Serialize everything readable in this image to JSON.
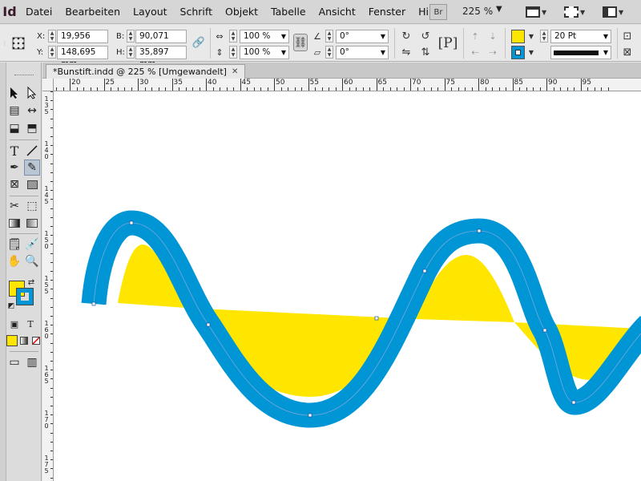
{
  "app": {
    "logo": "Id"
  },
  "menu": [
    {
      "label": "Datei"
    },
    {
      "label": "Bearbeiten"
    },
    {
      "label": "Layout"
    },
    {
      "label": "Schrift"
    },
    {
      "label": "Objekt"
    },
    {
      "label": "Tabelle"
    },
    {
      "label": "Ansicht"
    },
    {
      "label": "Fenster"
    },
    {
      "label": "Hilfe"
    }
  ],
  "menubar": {
    "bridge_label": "Br",
    "zoom": "225 %"
  },
  "control": {
    "x_label": "X:",
    "x_value": "19,956 mm",
    "y_label": "Y:",
    "y_value": "148,695 mm",
    "w_label": "B:",
    "w_value": "90,071 mm",
    "h_label": "H:",
    "h_value": "35,897 mm",
    "scale_x": "100 %",
    "scale_y": "100 %",
    "rotate": "0°",
    "shear": "0°",
    "stroke_weight": "20 Pt",
    "fill_color": "#ffe600",
    "stroke_color": "#0096d6"
  },
  "document": {
    "tab_title": "*Bunstift.indd @ 225 % [Umgewandelt]"
  },
  "ruler": {
    "h_labels": [
      "20",
      "25",
      "30",
      "35",
      "40",
      "45",
      "50",
      "55",
      "60",
      "65",
      "70",
      "75",
      "80",
      "85",
      "90",
      "95"
    ]
  },
  "icons": {
    "close": "close-icon",
    "selection": "selection-tool-icon",
    "direct": "direct-selection-tool-icon",
    "pencil": "pencil-tool-icon"
  },
  "artwork": {
    "fill": "#ffe600",
    "stroke": "#0096d6"
  }
}
